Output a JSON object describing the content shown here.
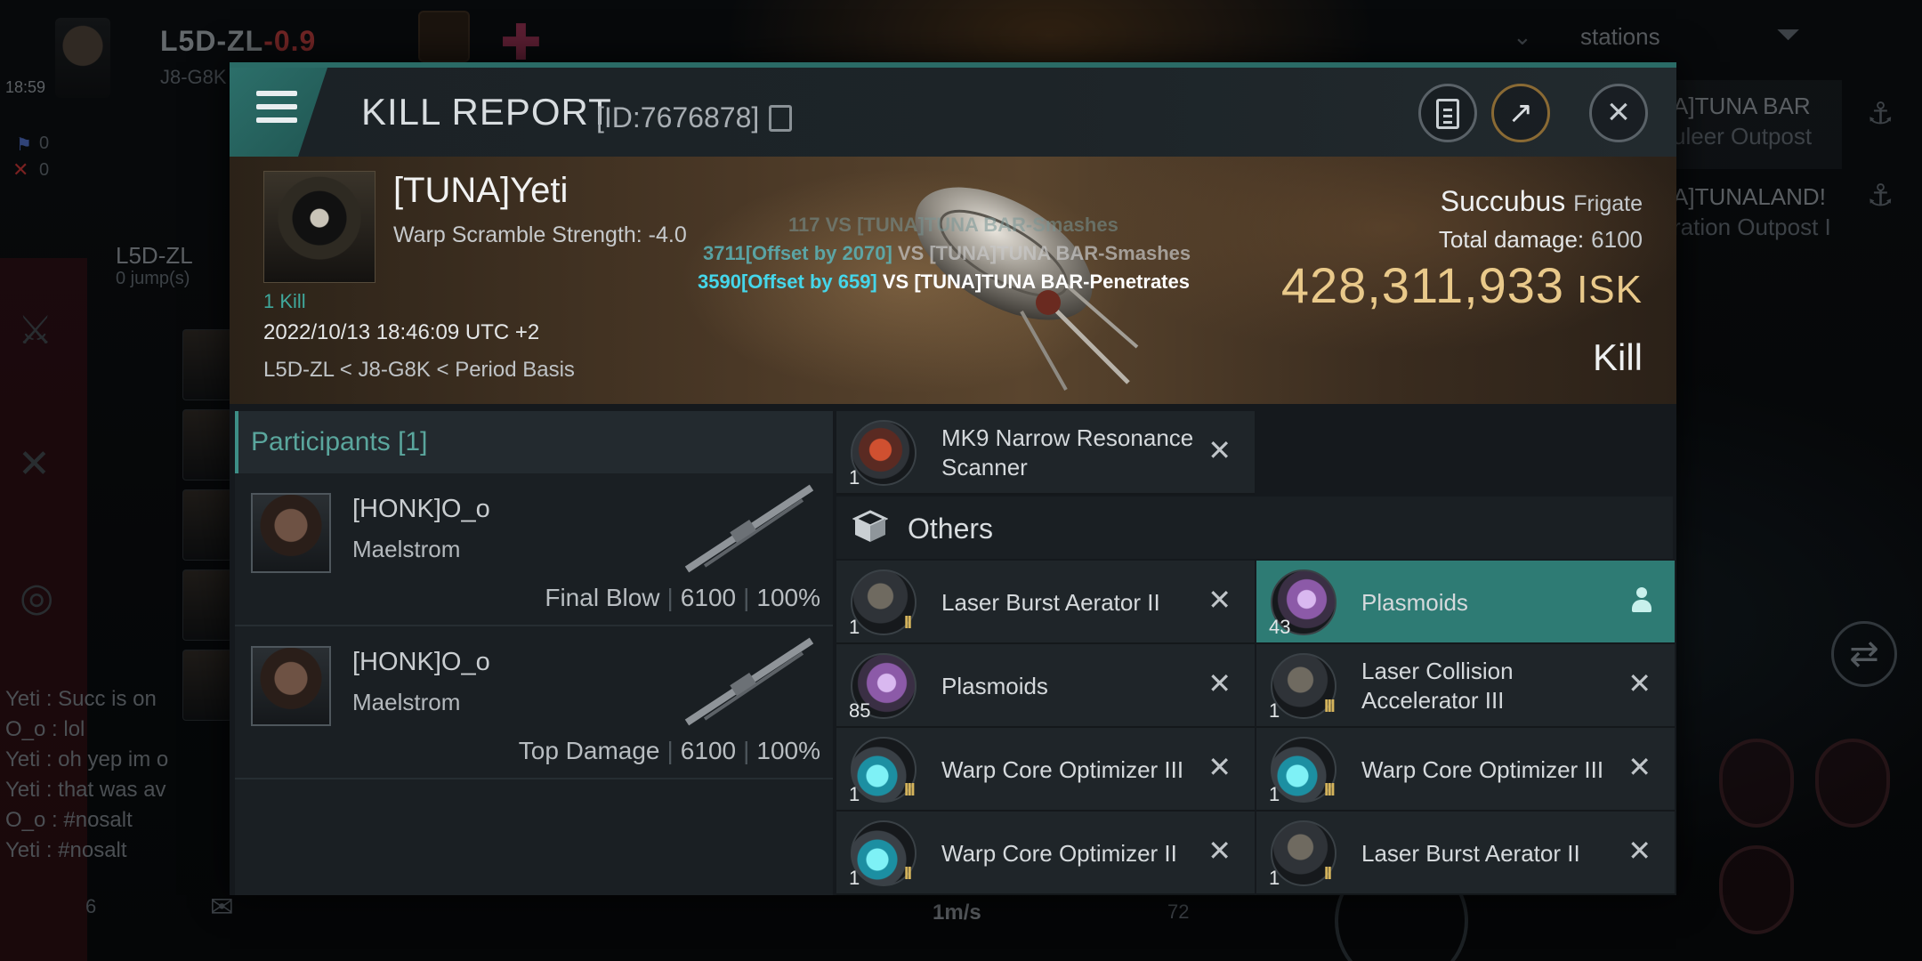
{
  "background": {
    "system": "L5D-ZL",
    "security": "-0.9",
    "subtitle": "J8-G8K",
    "time": "18:59",
    "counter_blue": "0",
    "counter_red": "0",
    "location_name": "L5D-ZL",
    "location_jumps": "0 jump(s)",
    "filter_label": "stations",
    "right_list": [
      "A]TUNA BAR",
      "uleer Outpost",
      "A]TUNALAND!",
      "ration Outpost I"
    ],
    "chat": [
      "Yeti : Succ is on",
      "O_o : lol",
      "Yeti : oh yep im o",
      "Yeti : that was av",
      "O_o : #nosalt",
      "Yeti : #nosalt"
    ],
    "speed": "1m/s",
    "bottom_value": "72",
    "bottom_left_value": "6"
  },
  "header": {
    "title": "KILL REPORT",
    "report_id": "[ID:7676878]"
  },
  "victim": {
    "name": "[TUNA]Yeti",
    "scramble": "Warp Scramble Strength: -4.0",
    "kills": "1 Kill",
    "datetime": "2022/10/13 18:46:09 UTC +2",
    "route": "L5D-ZL < J8-G8K < Period Basis",
    "ship_name": "Succubus",
    "ship_class": "Frigate",
    "total_damage_label": "Total damage:",
    "total_damage": "6100",
    "isk_value": "428,311,933",
    "isk_unit": "ISK",
    "outcome": "Kill"
  },
  "floating_text": {
    "line1": "117 VS [TUNA]TUNA BAR-Smashes",
    "line2_num": "3711[Offset by 2070]",
    "line2_rest": " VS [TUNA]TUNA BAR-Smashes",
    "line3_num": "3590[Offset by 659]",
    "line3_rest": " VS [TUNA]TUNA BAR-Penetrates"
  },
  "participants": {
    "title": "Participants [1]",
    "rows": [
      {
        "name": "[HONK]O_o",
        "ship": "Maelstrom",
        "role": "Final Blow",
        "damage": "6100",
        "percent": "100%"
      },
      {
        "name": "[HONK]O_o",
        "ship": "Maelstrom",
        "role": "Top Damage",
        "damage": "6100",
        "percent": "100%"
      }
    ]
  },
  "items": {
    "scanner": {
      "name": "MK9 Narrow Resonance Scanner",
      "qty": "1"
    },
    "others_label": "Others",
    "list": [
      {
        "name": "Laser Burst Aerator II",
        "qty": "1",
        "tier": "II",
        "icon": "laser-icon"
      },
      {
        "name": "Plasmoids",
        "qty": "43",
        "tier": "",
        "icon": "plasmoid-icon",
        "selected": true
      },
      {
        "name": "Plasmoids",
        "qty": "85",
        "tier": "",
        "icon": "plasmoid-icon"
      },
      {
        "name": "Laser Collision Accelerator III",
        "qty": "1",
        "tier": "III",
        "icon": "laser-icon"
      },
      {
        "name": "Warp Core Optimizer III",
        "qty": "1",
        "tier": "III",
        "icon": "warp-core-icon"
      },
      {
        "name": "Warp Core Optimizer III",
        "qty": "1",
        "tier": "III",
        "icon": "warp-core-icon"
      },
      {
        "name": "Warp Core Optimizer II",
        "qty": "1",
        "tier": "II",
        "icon": "warp-core-icon"
      },
      {
        "name": "Laser Burst Aerator II",
        "qty": "1",
        "tier": "II",
        "icon": "laser-icon"
      }
    ]
  },
  "colors": {
    "accent_teal": "#2e7b74",
    "isk_gold": "#e9c98a",
    "security_red": "#b03a3a",
    "damage_cyan": "#45d6ea"
  }
}
